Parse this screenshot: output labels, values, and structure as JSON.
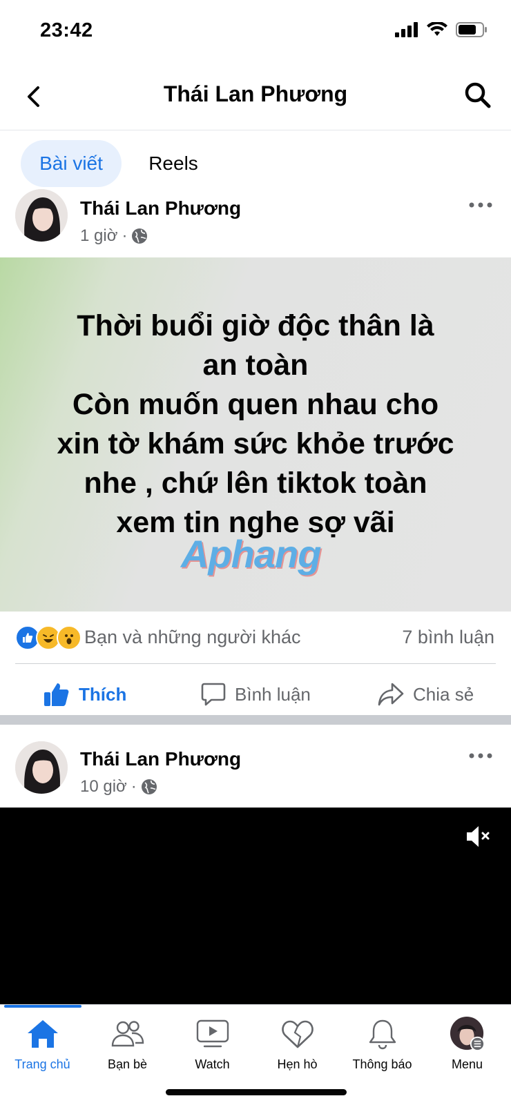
{
  "status_bar": {
    "time": "23:42"
  },
  "header": {
    "title": "Thái Lan Phương"
  },
  "tabs": [
    {
      "label": "Bài viết",
      "active": true
    },
    {
      "label": "Reels",
      "active": false
    }
  ],
  "posts": [
    {
      "author": "Thái Lan Phương",
      "time": "1 giờ",
      "content": "Thời buổi giờ độc thân là\nan toàn\nCòn muốn quen nhau cho\nxin tờ khám sức khỏe trước\nnhe , chứ lên tiktok toàn\nxem tin nghe sợ vãi",
      "watermark": "Aphang",
      "reactions": [
        "like-icon",
        "haha-icon",
        "wow-icon"
      ],
      "reaction_text": "Bạn và những người khác",
      "comment_count": "7 bình luận",
      "actions": {
        "like": "Thích",
        "comment": "Bình luận",
        "share": "Chia sẻ"
      }
    },
    {
      "author": "Thái Lan Phương",
      "time": "10 giờ"
    }
  ],
  "bottom_nav": [
    {
      "label": "Trang chủ",
      "icon": "home-icon",
      "active": true
    },
    {
      "label": "Bạn bè",
      "icon": "friends-icon",
      "active": false
    },
    {
      "label": "Watch",
      "icon": "watch-icon",
      "active": false
    },
    {
      "label": "Hẹn hò",
      "icon": "dating-icon",
      "active": false
    },
    {
      "label": "Thông báo",
      "icon": "bell-icon",
      "active": false
    },
    {
      "label": "Menu",
      "icon": "profile-avatar-icon",
      "active": false
    }
  ],
  "colors": {
    "accent": "#1b74e4",
    "muted_text": "#65676b"
  }
}
